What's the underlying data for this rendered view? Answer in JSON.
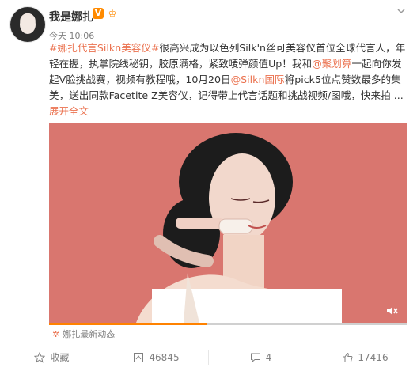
{
  "post": {
    "username": "我是娜扎",
    "vip_badge": "V",
    "crown_badge": "♔",
    "timestamp": "今天 10:06",
    "text": {
      "p1_link": "#娜扎代言Silkn美容仪#",
      "p1": "很高兴成为以色列Silk'n丝可美容仪首位全球代言人，年轻在握，执掌院线秘钥，胶原满格，紧致唛弹颜值Up！我和",
      "p2_link": "@聚划算",
      "p2": "一起向你发起V脸挑战赛，视频有教程哦，10月20日",
      "p3_link": "@Silkn国际",
      "p3": "将pick5位点赞数最多的集美，送出同款Facetite Z美容仪，记得带上代言话题和挑战视频/图哦，快来拍 ..."
    },
    "expand_label": "展开全文",
    "latest_label": "娜扎最新动态",
    "video": {
      "progress_percent": 44
    }
  },
  "actions": {
    "favorite_label": "收藏",
    "repost_count": "46845",
    "comment_count": "4",
    "like_count": "17416"
  },
  "colors": {
    "link": "#eb7350",
    "accent": "#ff8200",
    "background": "#d9766f"
  }
}
